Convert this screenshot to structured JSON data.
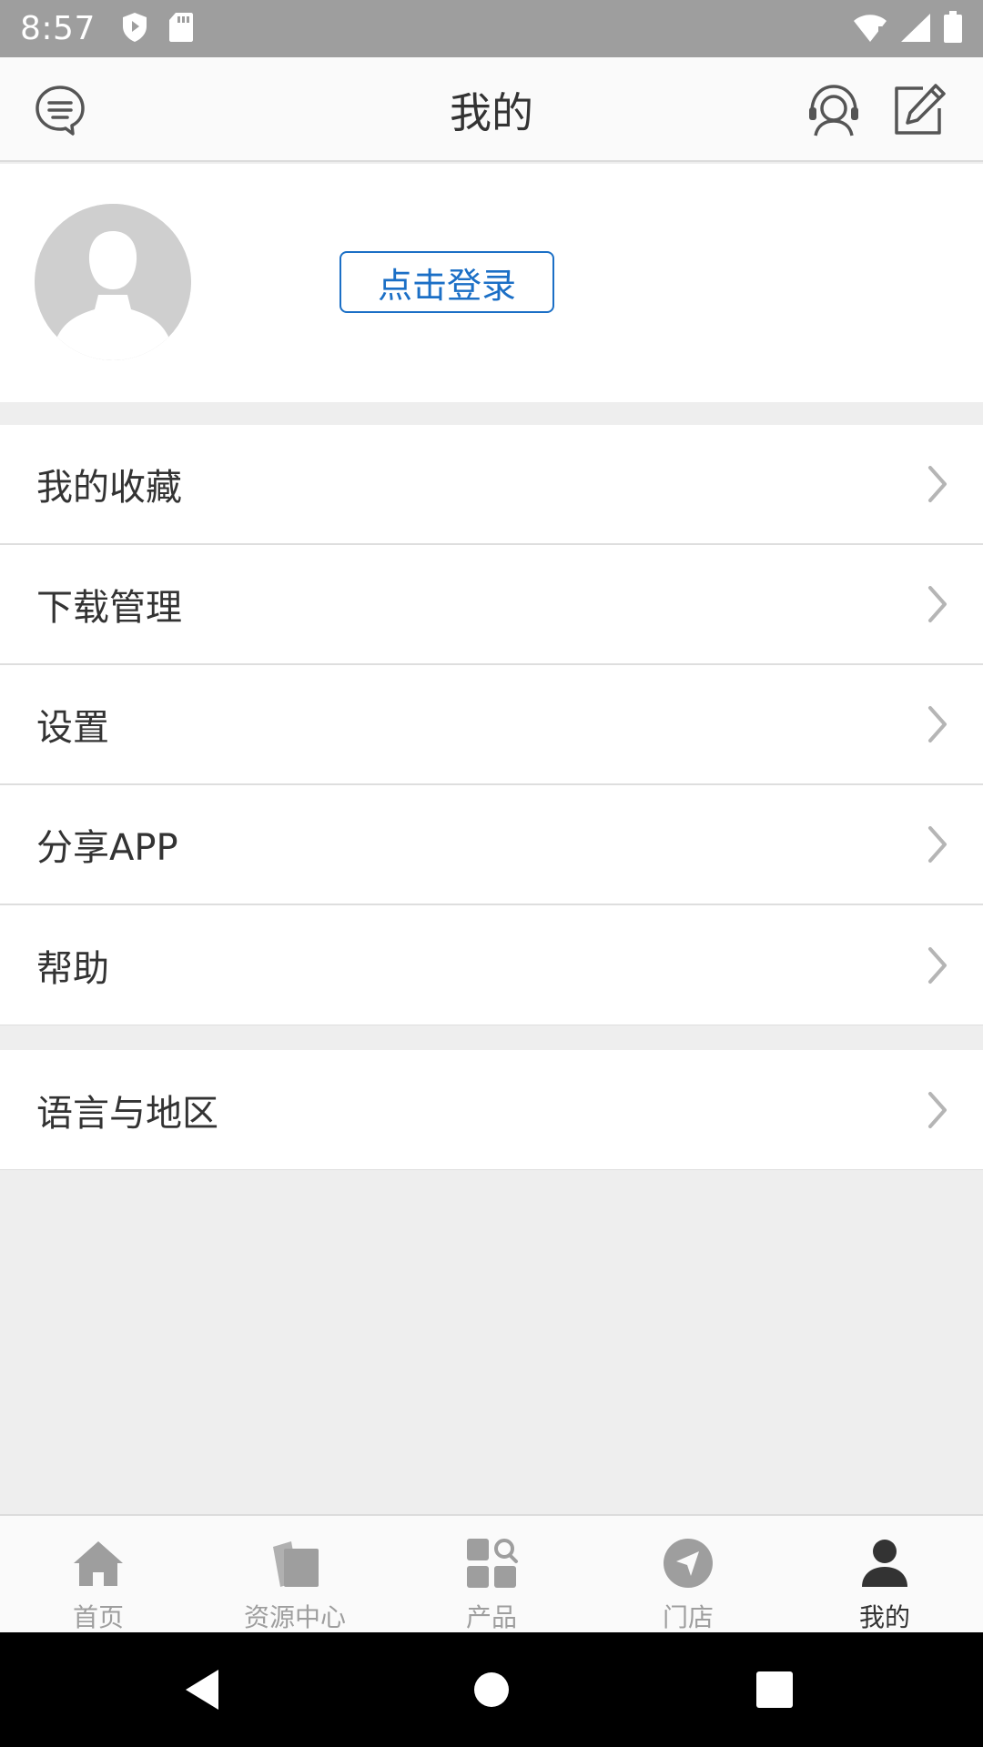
{
  "status_bar": {
    "time": "8:57",
    "left_icons": [
      "shield-icon",
      "sd-card-icon"
    ],
    "right_icons": [
      "wifi-icon",
      "signal-icon",
      "battery-icon"
    ]
  },
  "header": {
    "title": "我的",
    "left_icon": "message-icon",
    "right_icons": [
      "customer-service-icon",
      "edit-icon"
    ]
  },
  "profile": {
    "login_label": "点击登录"
  },
  "menu_groups": [
    {
      "items": [
        {
          "label": "我的收藏"
        },
        {
          "label": "下载管理"
        },
        {
          "label": "设置"
        },
        {
          "label": "分享APP"
        },
        {
          "label": "帮助"
        }
      ]
    },
    {
      "items": [
        {
          "label": "语言与地区"
        }
      ]
    }
  ],
  "bottom_nav": {
    "items": [
      {
        "label": "首页",
        "icon": "home-icon"
      },
      {
        "label": "资源中心",
        "icon": "documents-icon"
      },
      {
        "label": "产品",
        "icon": "product-search-icon"
      },
      {
        "label": "门店",
        "icon": "location-arrow-icon"
      },
      {
        "label": "我的",
        "icon": "person-icon",
        "active": true
      }
    ]
  },
  "colors": {
    "accent": "#1b6fc6",
    "inactive": "#9e9e9e",
    "active": "#333333",
    "background": "#eeeeee"
  }
}
